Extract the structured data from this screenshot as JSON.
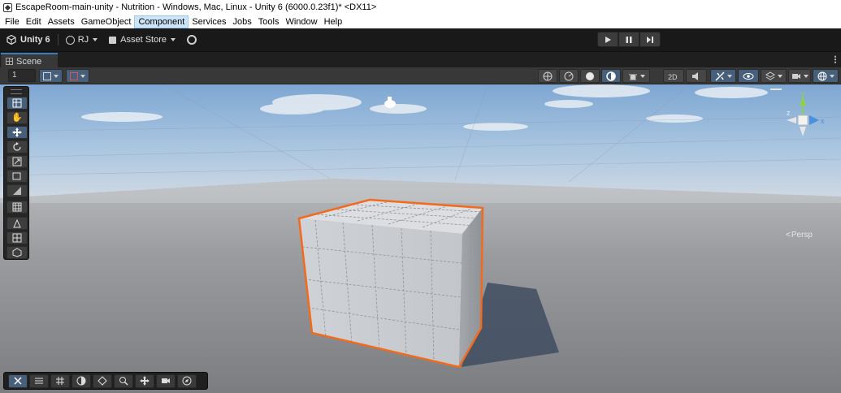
{
  "window": {
    "title": "EscapeRoom-main-unity - Nutrition - Windows, Mac, Linux - Unity 6 (6000.0.23f1)* <DX11>"
  },
  "menu": [
    "File",
    "Edit",
    "Assets",
    "GameObject",
    "Component",
    "Services",
    "Jobs",
    "Tools",
    "Window",
    "Help"
  ],
  "menu_active": "Component",
  "toolbar": {
    "unity_label": "Unity 6",
    "account_label": "RJ",
    "asset_store_label": "Asset Store"
  },
  "playmode": {
    "play": "play-icon",
    "pause": "pause-icon",
    "step": "step-icon"
  },
  "tab": {
    "scene_label": "Scene"
  },
  "scene_toolbar": {
    "layer_field": "1",
    "right_icons": [
      "center-icon",
      "global-icon",
      "shading-icon",
      "draw-mode-icon",
      "debug-icon",
      "2d-icon",
      "audio-icon",
      "effects-icon",
      "visibility-icon",
      "layers-icon",
      "camera-icon",
      "gizmos-icon"
    ]
  },
  "tools": [
    "view-tool-icon",
    "hand-icon",
    "move-icon",
    "rotate-icon",
    "scale-icon",
    "rect-icon",
    "transform-icon",
    "grid-icon",
    "custom-icon",
    "snap-icon",
    "probe-icon"
  ],
  "bottom_tools": [
    "tools-icon",
    "settings-icon",
    "grid-icon",
    "shading-icon",
    "nav-icon",
    "search-icon",
    "move-icon",
    "camera-icon",
    "compass-icon"
  ],
  "gizmo": {
    "projection_label": "Persp",
    "axis_y": "y",
    "axis_x": "x",
    "axis_z": "z"
  },
  "colors": {
    "selection_outline": "#f26b1d",
    "accent_blue": "#46607c",
    "tab_accent": "#3a79bb"
  }
}
